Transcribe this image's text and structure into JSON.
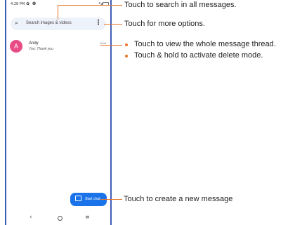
{
  "status_bar": {
    "time": "4:28 PM",
    "left_icons": "✿ ❻",
    "right_icons": "▾◢"
  },
  "search": {
    "placeholder": "Search images & videos"
  },
  "conversation": {
    "avatar_letter": "A",
    "name": "Andy",
    "preview": "You: Thank you",
    "time": "Draft"
  },
  "fab": {
    "label": "Start chat"
  },
  "nav": {
    "back": "‹",
    "recent": "≡"
  },
  "callouts": {
    "search": "Touch to search in all messages.",
    "more": "Touch for more options.",
    "view_thread": "Touch to view the whole message thread.",
    "delete_mode": "Touch & hold to activate delete mode.",
    "new_message": "Touch to create a new message"
  },
  "colors": {
    "frame": "#3f5db6",
    "accent": "#e8752a",
    "fab": "#1a73e8",
    "avatar": "#e84c86"
  }
}
